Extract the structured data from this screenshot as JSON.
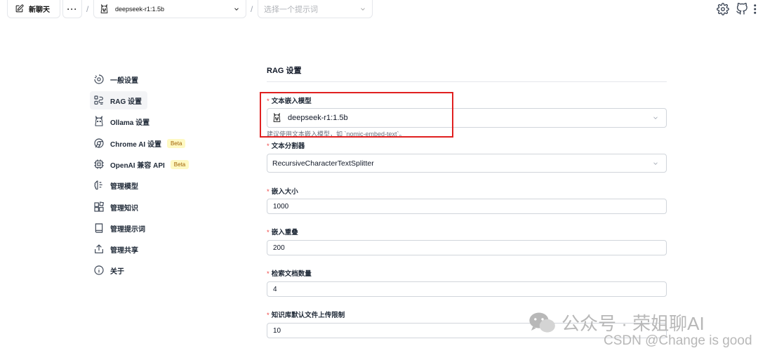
{
  "topbar": {
    "new_chat_label": "新聊天",
    "more_label": "···",
    "separator": "/",
    "model_label": "deepseek-r1:1.5b",
    "prompt_placeholder": "选择一个提示词"
  },
  "sidebar": {
    "items": [
      {
        "label": "一般设置",
        "icon": "gear-icon"
      },
      {
        "label": "RAG 设置",
        "icon": "rag-icon"
      },
      {
        "label": "Ollama 设置",
        "icon": "ollama-icon"
      },
      {
        "label": "Chrome AI 设置",
        "icon": "chrome-icon",
        "badge": "Beta"
      },
      {
        "label": "OpenAI 兼容 API",
        "icon": "chip-icon",
        "badge": "Beta"
      },
      {
        "label": "管理模型",
        "icon": "brain-icon"
      },
      {
        "label": "管理知识",
        "icon": "blocks-icon"
      },
      {
        "label": "管理提示词",
        "icon": "book-icon"
      },
      {
        "label": "管理共享",
        "icon": "share-icon"
      },
      {
        "label": "关于",
        "icon": "info-icon"
      }
    ],
    "active_index": 1
  },
  "main": {
    "title": "RAG 设置",
    "fields": {
      "embedding_model": {
        "label": "文本嵌入模型",
        "value": "deepseek-r1:1.5b",
        "help": "建议使用文本嵌入模型，如 `nomic-embed-text`。"
      },
      "splitter": {
        "label": "文本分割器",
        "value": "RecursiveCharacterTextSplitter"
      },
      "chunk_size": {
        "label": "嵌入大小",
        "value": "1000"
      },
      "chunk_overlap": {
        "label": "嵌入重叠",
        "value": "200"
      },
      "doc_count": {
        "label": "检索文档数量",
        "value": "4"
      },
      "upload_limit": {
        "label": "知识库默认文件上传限制",
        "value": "10"
      }
    },
    "required_mark": "*"
  },
  "watermark": {
    "line1": "公众号 · 荣姐聊AI",
    "line2": "CSDN @Change is good"
  },
  "colors": {
    "highlight": "#e02020",
    "beta_bg": "#fef9c3",
    "required": "#ef4444"
  }
}
